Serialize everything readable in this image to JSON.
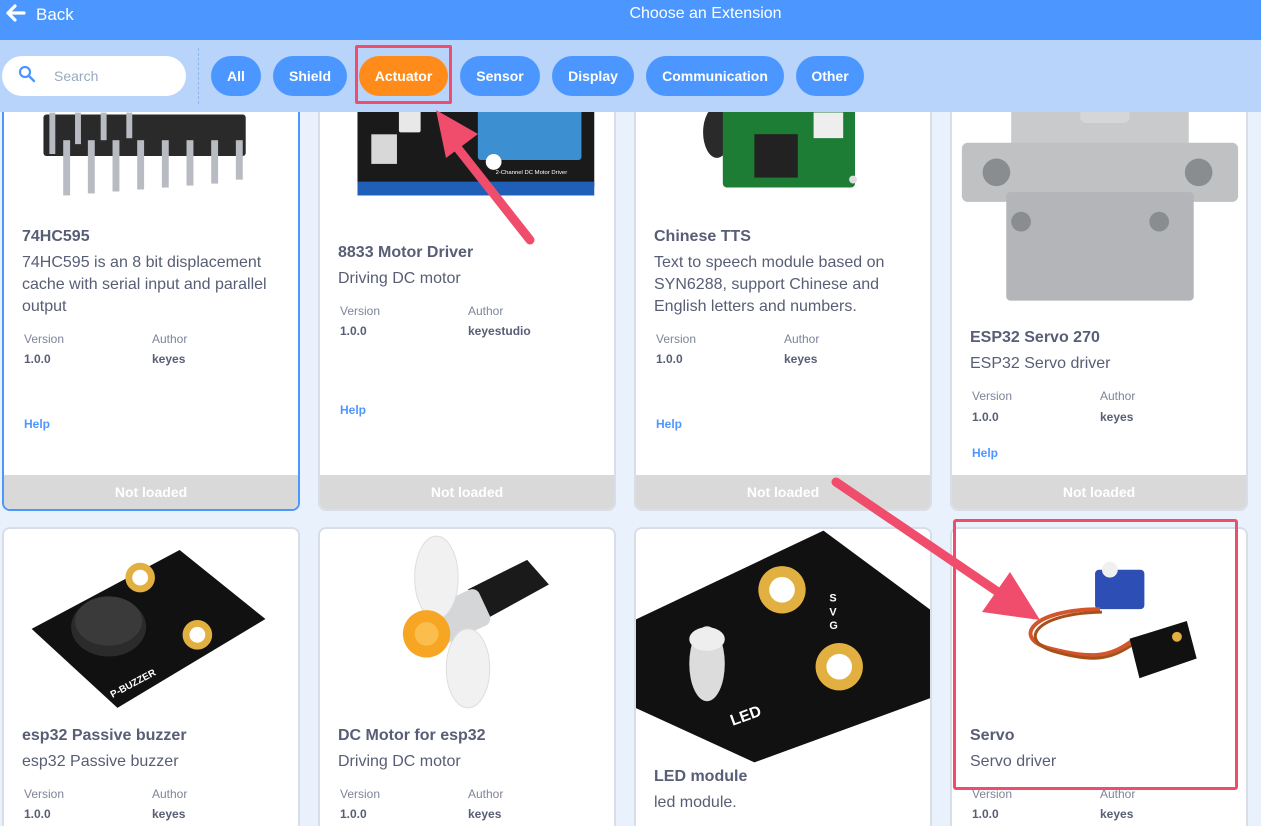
{
  "header": {
    "back_label": "Back",
    "title": "Choose an Extension"
  },
  "search": {
    "placeholder": "Search"
  },
  "filters": [
    "All",
    "Shield",
    "Actuator",
    "Sensor",
    "Display",
    "Communication",
    "Other"
  ],
  "active_filter": "Actuator",
  "labels": {
    "version": "Version",
    "author": "Author",
    "help": "Help",
    "not_loaded": "Not loaded"
  },
  "cards": [
    {
      "name": "74HC595",
      "description": "74HC595 is an 8 bit displacement cache with serial input and parallel output",
      "version": "1.0.0",
      "author": "keyes"
    },
    {
      "name": "8833 Motor Driver",
      "description": "Driving DC motor",
      "version": "1.0.0",
      "author": "keyestudio"
    },
    {
      "name": "Chinese TTS",
      "description": "Text to speech module based on SYN6288, support Chinese and English letters and numbers.",
      "version": "1.0.0",
      "author": "keyes"
    },
    {
      "name": "ESP32 Servo 270",
      "description": "ESP32 Servo driver",
      "version": "1.0.0",
      "author": "keyes"
    },
    {
      "name": "esp32 Passive buzzer",
      "description": "esp32 Passive buzzer",
      "version": "1.0.0",
      "author": "keyes"
    },
    {
      "name": "DC Motor for esp32",
      "description": "Driving DC motor",
      "version": "1.0.0",
      "author": "keyes"
    },
    {
      "name": "LED module",
      "description": "led module."
    },
    {
      "name": "Servo",
      "description": "Servo driver",
      "version": "1.0.0",
      "author": "keyes"
    }
  ],
  "image_texts": {
    "motor_board": "2-Channel DC Motor Driver",
    "buzzer_board": "P-BUZZER",
    "led_board": "LED",
    "pins": [
      "S",
      "V",
      "G"
    ]
  },
  "colors": {
    "accent": "#4c97ff",
    "active_filter": "#ff8c1a",
    "highlight": "#ef4d6b",
    "footer": "#d9d9d9"
  }
}
